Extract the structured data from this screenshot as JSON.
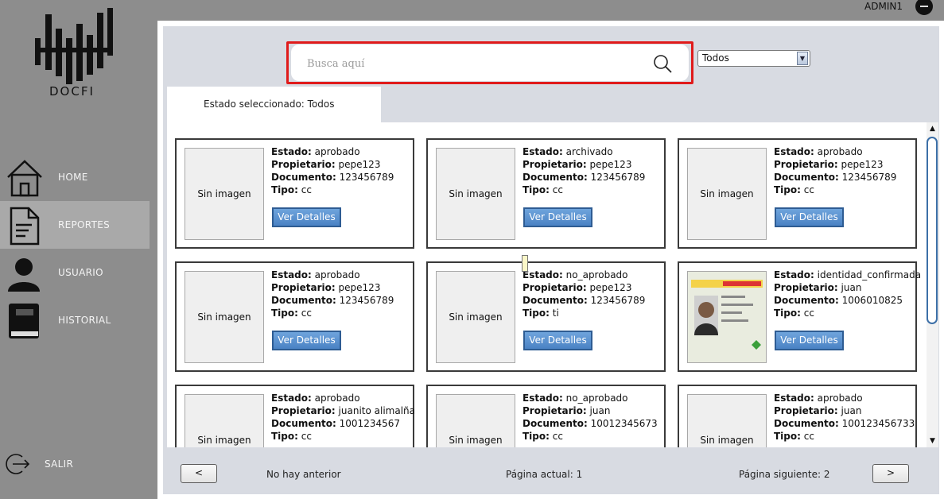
{
  "app": {
    "logo_text": "DOCFI"
  },
  "header": {
    "user_name": "ADMIN1"
  },
  "sidebar": {
    "items": [
      {
        "label": "HOME",
        "icon": "home-icon"
      },
      {
        "label": "REPORTES",
        "icon": "document-icon",
        "active": true
      },
      {
        "label": "USUARIO",
        "icon": "user-icon"
      },
      {
        "label": "HISTORIAL",
        "icon": "book-icon"
      }
    ],
    "logout_label": "SALIR"
  },
  "search": {
    "placeholder": "Busca aquí",
    "value": ""
  },
  "filter": {
    "selected": "Todos"
  },
  "state_tab": {
    "label": "Estado seleccionado: Todos"
  },
  "labels": {
    "estado": "Estado:",
    "propietario": "Propietario:",
    "documento": "Documento:",
    "tipo": "Tipo:",
    "no_image": "Sin imagen",
    "details_button": "Ver Detalles"
  },
  "cards": [
    {
      "estado": "aprobado",
      "propietario": "pepe123",
      "documento": "123456789",
      "tipo": "cc",
      "image": "none"
    },
    {
      "estado": "archivado",
      "propietario": "pepe123",
      "documento": "123456789",
      "tipo": "cc",
      "image": "none"
    },
    {
      "estado": "aprobado",
      "propietario": "pepe123",
      "documento": "123456789",
      "tipo": "cc",
      "image": "none"
    },
    {
      "estado": "aprobado",
      "propietario": "pepe123",
      "documento": "123456789",
      "tipo": "cc",
      "image": "none"
    },
    {
      "estado": "no_aprobado",
      "propietario": "pepe123",
      "documento": "123456789",
      "tipo": "ti",
      "image": "none"
    },
    {
      "estado": "identidad_confirmada",
      "propietario": "juan",
      "documento": "1006010825",
      "tipo": "cc",
      "image": "id-card-photo"
    },
    {
      "estado": "aprobado",
      "propietario": "juanito alimalña",
      "documento": "1001234567",
      "tipo": "cc",
      "image": "none"
    },
    {
      "estado": "no_aprobado",
      "propietario": "juan",
      "documento": "10012345673",
      "tipo": "cc",
      "image": "none"
    },
    {
      "estado": "aprobado",
      "propietario": "juan",
      "documento": "100123456733",
      "tipo": "cc",
      "image": "none"
    }
  ],
  "pagination": {
    "prev_label": "<",
    "next_label": ">",
    "prev_text": "No hay anterior",
    "current_text": "Página actual: 1",
    "next_text": "Página siguiente: 2"
  },
  "colors": {
    "sidebar_bg": "#8d8d8d",
    "active_nav": "#a9a9a9",
    "button_blue": "#4a82c4",
    "search_highlight": "#e01b1b"
  }
}
